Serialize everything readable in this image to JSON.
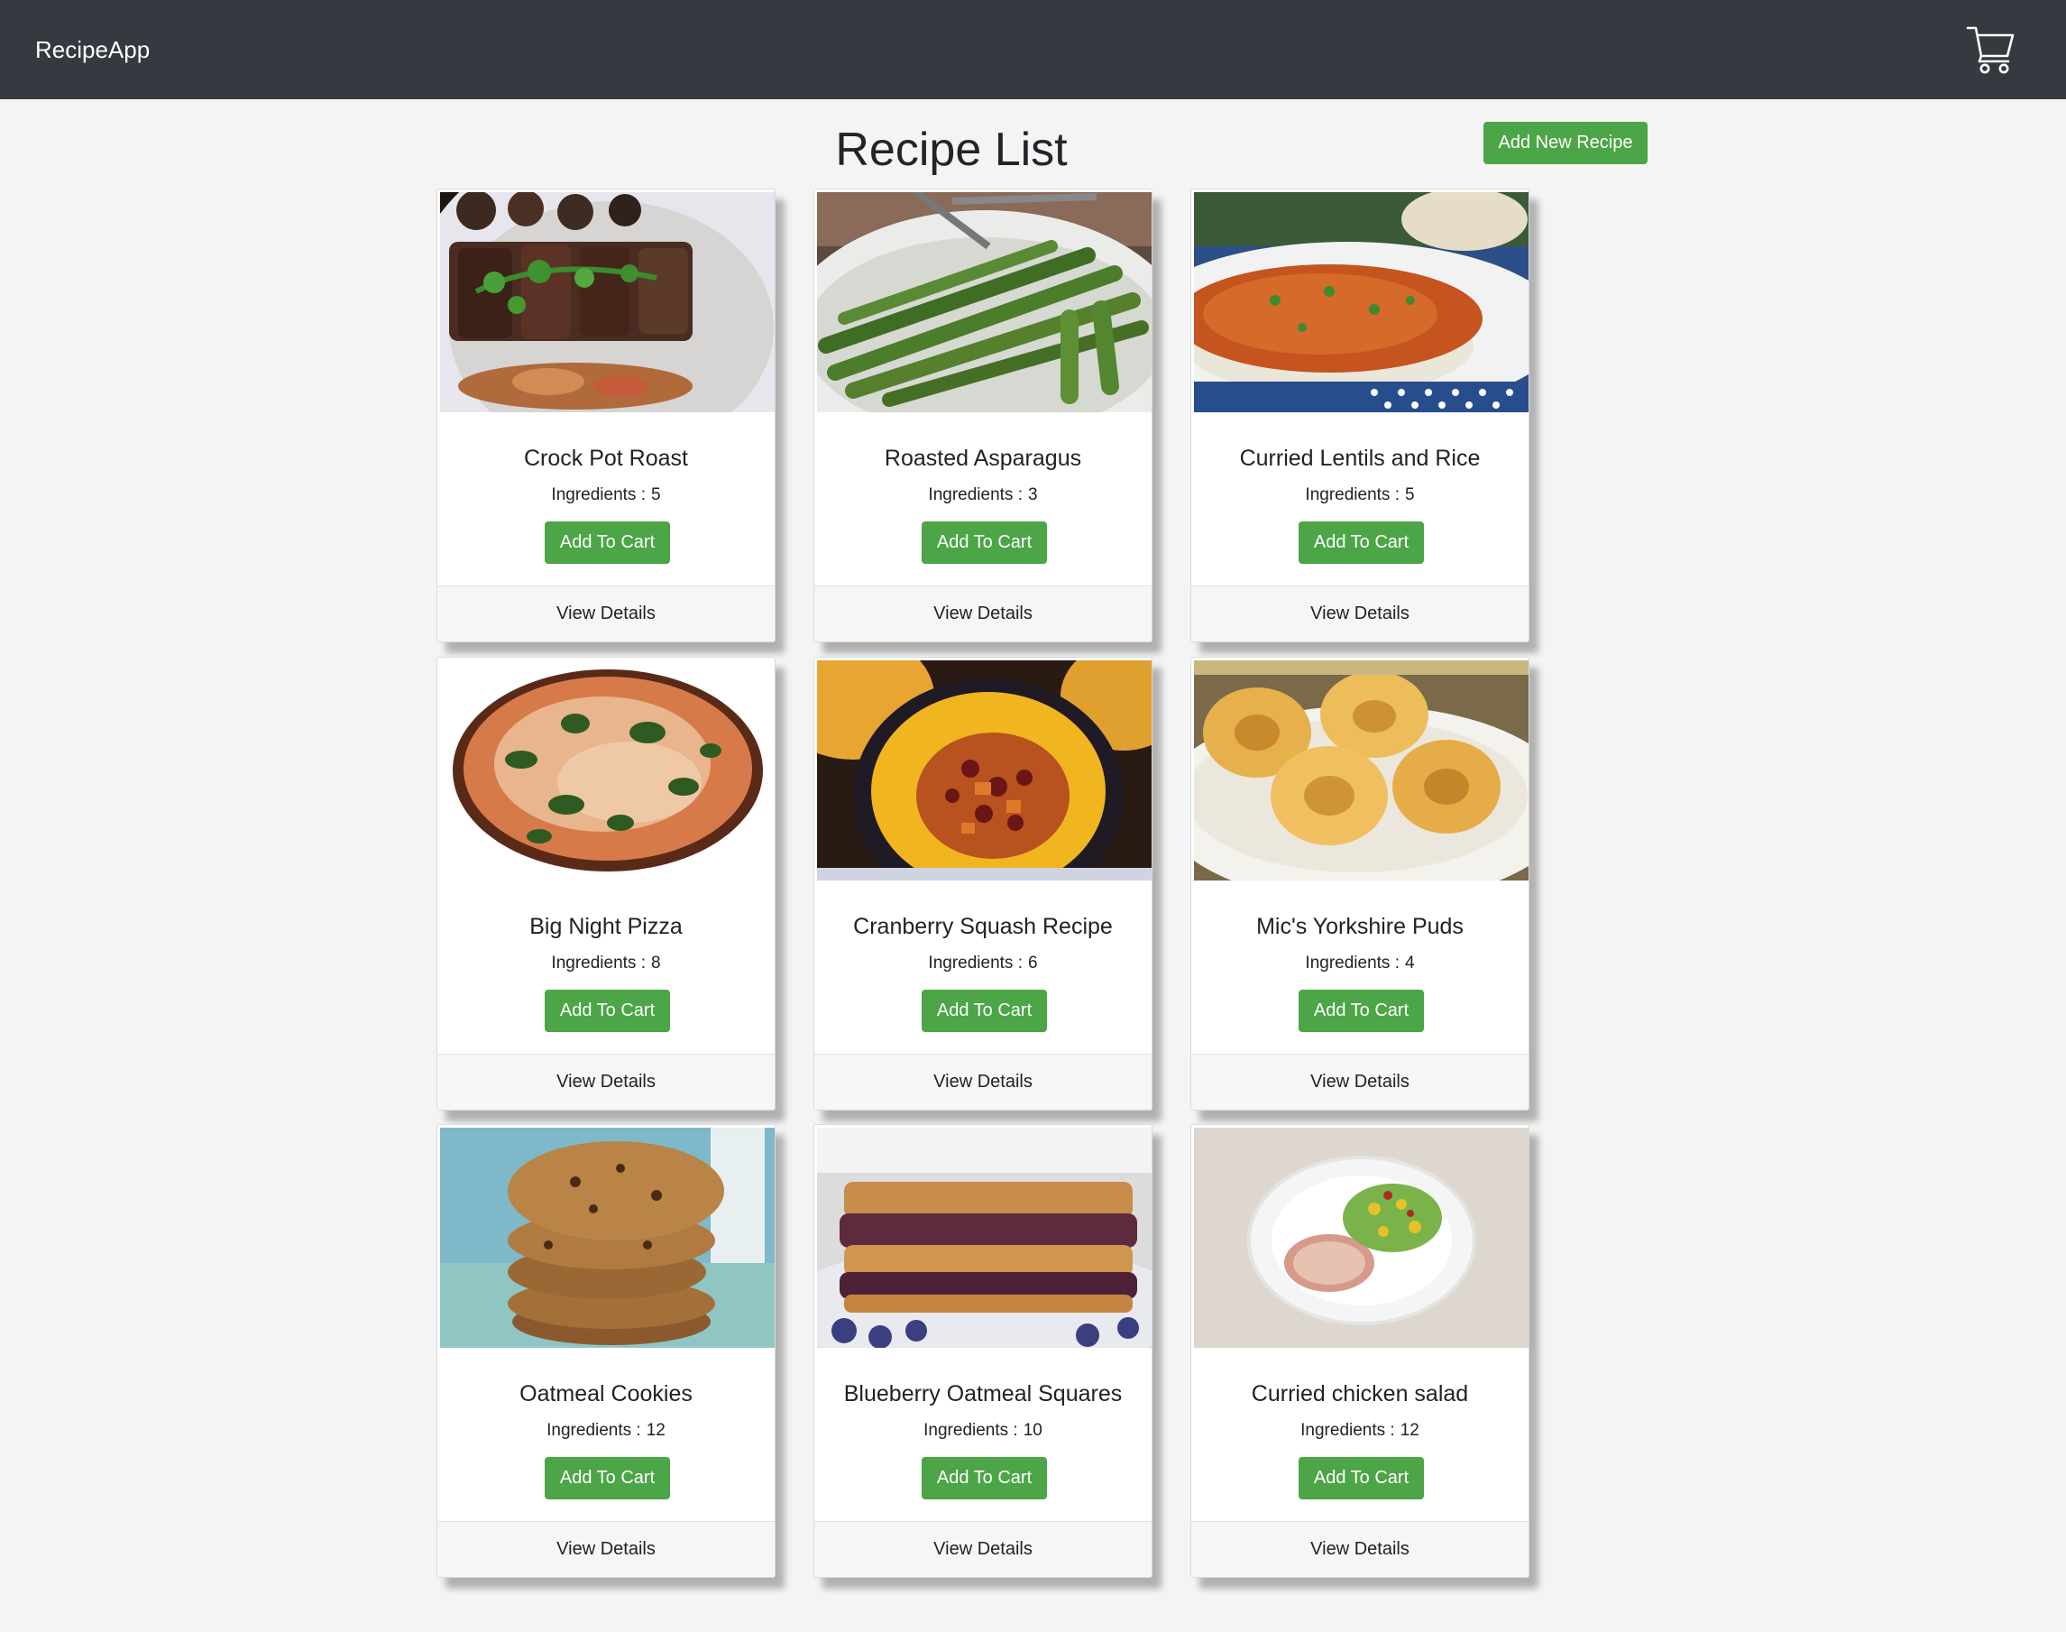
{
  "app": {
    "brand": "RecipeApp",
    "cart_icon": "shopping-cart-icon"
  },
  "page": {
    "title": "Recipe List",
    "add_button": "Add New Recipe"
  },
  "card_labels": {
    "ingredients_label": "Ingredients :",
    "add_to_cart": "Add To Cart",
    "view_details": "View Details"
  },
  "colors": {
    "navbar": "#343a40",
    "button_green": "#4ca546",
    "background": "#f4f4f4"
  },
  "recipes": [
    {
      "name": "Crock Pot Roast",
      "ingredients": "5"
    },
    {
      "name": "Roasted Asparagus",
      "ingredients": "3"
    },
    {
      "name": "Curried Lentils and Rice",
      "ingredients": "5"
    },
    {
      "name": "Big Night Pizza",
      "ingredients": "8"
    },
    {
      "name": "Cranberry Squash Recipe",
      "ingredients": "6"
    },
    {
      "name": "Mic's Yorkshire Puds",
      "ingredients": "4"
    },
    {
      "name": "Oatmeal Cookies",
      "ingredients": "12"
    },
    {
      "name": "Blueberry Oatmeal Squares",
      "ingredients": "10"
    },
    {
      "name": "Curried chicken salad",
      "ingredients": "12"
    }
  ]
}
